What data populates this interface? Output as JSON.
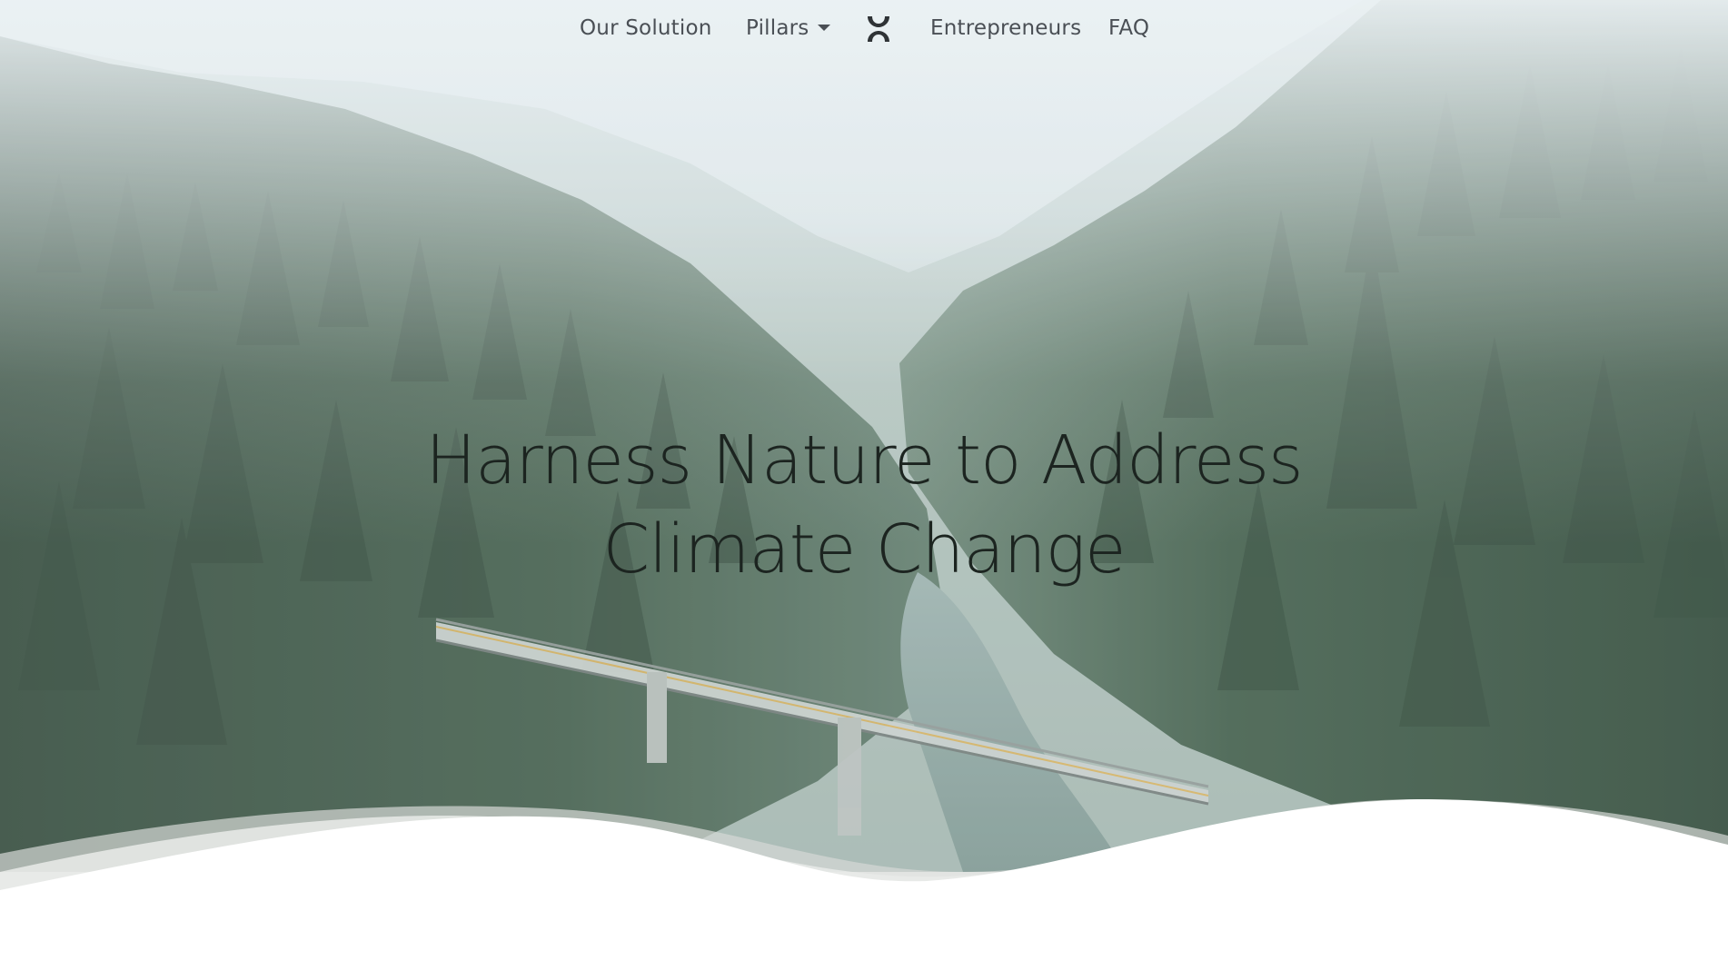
{
  "nav": {
    "items": [
      {
        "label": "Our Solution"
      },
      {
        "label": "Pillars",
        "has_dropdown": true
      },
      {
        "label": "Entrepreneurs"
      },
      {
        "label": "FAQ"
      }
    ],
    "logo_icon": "brand-logo-icon"
  },
  "hero": {
    "headline_line1": "Harness Nature to Address",
    "headline_line2": "Climate Change",
    "background": "misty-forest-river-bridge-photo"
  },
  "colors": {
    "nav_text": "#4a4f55",
    "headline_text": "#1c2420",
    "forest_dark": "#2f4a3a",
    "mist": "#e8eef2"
  }
}
